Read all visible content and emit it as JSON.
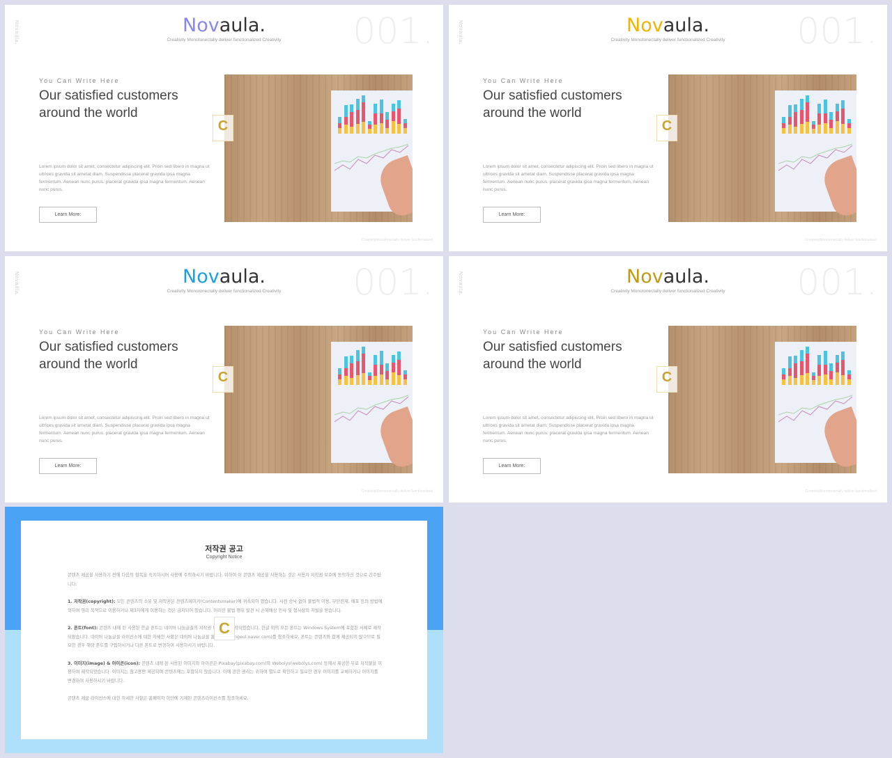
{
  "slides": [
    {
      "brand_accent": "Nov",
      "brand_rest": "aula.",
      "accent_color": "#8b87e8"
    },
    {
      "brand_accent": "Nov",
      "brand_rest": "aula.",
      "accent_color": "#f0b400"
    },
    {
      "brand_accent": "Nov",
      "brand_rest": "aula.",
      "accent_color": "#1ea0dc"
    },
    {
      "brand_accent": "Nov",
      "brand_rest": "aula.",
      "accent_color": "#c09a10"
    }
  ],
  "common": {
    "vertical_label": "Novaula.",
    "subtitle": "Creativity Monotonectally deliver functionalized Creativity",
    "number": "001.",
    "kicker": "You Can Write Here",
    "heading": "Our satisfied customers around the world",
    "lorem": "Lorem ipsum dolor sit amet, consectetur adipiscing elit. Proin sed libero in magna ut ultrices gravida sit ametat diam. Suspendisse placerat gravida ipsa magna fermentum.  Aenean nunc purus. placerat gravida ipsa magna fermentum.  Aenean nunc purus.",
    "button": "Learn More:",
    "footer": "CreativityMonotonectally deliver functionalized",
    "badge": "C"
  },
  "copyright": {
    "title": "저작권 공고",
    "subtitle": "Copyright Notice",
    "intro": "콘텐츠 제공을 사용하기 전에 다음의 항목을 숙지하시어 사용에 주의하시기 바랍니다. 위하여 이 콘텐츠 제공을 사용하는 것은 사용자 저작권 보호에 동의하신 것으로 간주됩니다.",
    "s1_label": "1. 저작권(copyright):",
    "s1": "모든 콘텐츠의 소유 및 저작권은 콘텐츠메이커(Contentsmaker)에 귀속되어 있습니다. 사전 승낙 없이 불법적 이용, 무단전재, 배포 등의 방법에 의하여 영리 목적으로 이용하거나 제3자에게 이용하는 것은 금지되어 있습니다. 이러한 불법 행위 발견 시 손해배상 민사 및 형사상의 처벌을 받습니다.",
    "s2_label": "2. 폰트(font):",
    "s2": "콘텐츠 내에 된 사용된 한글 폰트는 네이버 나눔글꼴의 저작권 보호하에 제작되었습니다. 한글 외의 모든 폰트는 Windows System에 포함된 서체로 제작되었습니다. 네이버 나눔글꼴 라이선스에 대한 자세한 사항은 네이버 나눔글꼴 홈페이지(hangeul.naver.com)를 참조하세요. 폰트는 콘텐츠와 함께 제공되지 않으므로 필요한 경우 해당 폰트를 구입하시거나 다른 폰트로 변경하여 사용하시기 바랍니다.",
    "s3_label": "3. 이미지(image) & 아이콘(icon):",
    "s3": "콘텐츠 내에 된 사용된 이미지와 아이콘은 Pixabay(pixabay.com)와 Webolys(webolys.com) 등에서 제공한 무료 저작물을 이용하여 제작되었습니다. 이미지는 참고용만 제공되며 콘텐츠에는 포함되지 않습니다. 이에 관한 권리는 위하여 별도로 확인하고 필요한 경우 이미지를 교체하거나 이미지를 변경하여 사용하시기 바랍니다.",
    "outro": "콘텐츠 제공 라이선스에 대한 자세한 사항은 홈페이지 하단에 기재된 콘텐츠라이선스를 참조하세요."
  }
}
